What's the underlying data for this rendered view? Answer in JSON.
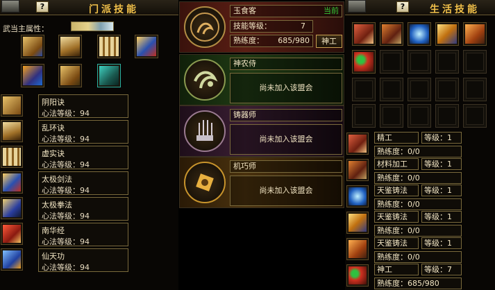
{
  "sect_panel": {
    "title": "门派技能",
    "help": "?",
    "attribute_label": "武当主属性：",
    "skill_icons": [
      "scroll-icon",
      "open-book-icon",
      "scroll-bundle-icon",
      "blue-book-icon",
      "spirit-book-icon",
      "scroll-icon",
      "green-book-icon"
    ],
    "skills": [
      {
        "name": "阴阳诀",
        "level": "心法等级：94",
        "icon": "scroll-icon"
      },
      {
        "name": "乱环诀",
        "level": "心法等级：94",
        "icon": "open-book-icon"
      },
      {
        "name": "虚实诀",
        "level": "心法等级：94",
        "icon": "scroll-bundle-icon"
      },
      {
        "name": "太极剑法",
        "level": "心法等级：94",
        "icon": "blue-book-icon"
      },
      {
        "name": "太极拳法",
        "level": "心法等级：94",
        "icon": "blue-book-icon"
      },
      {
        "name": "南华经",
        "level": "心法等级：94",
        "icon": "red-book-icon"
      },
      {
        "name": "仙天功",
        "level": "心法等级：94",
        "icon": "spirit-book-icon"
      }
    ]
  },
  "professions": [
    {
      "name": "玉食客",
      "status": "当前",
      "skill_level_label": "技能等级：",
      "skill_level_value": "7",
      "proficiency_label": "熟练度：",
      "proficiency_value": "685/980",
      "button": "神工",
      "emblem": "chef-emblem-icon",
      "color": "#5a1e14"
    },
    {
      "name": "神农侍",
      "message": "尚未加入该盟会",
      "emblem": "herb-emblem-icon",
      "color": "#1f3a14"
    },
    {
      "name": "铸器师",
      "message": "尚未加入该盟会",
      "emblem": "forge-emblem-icon",
      "color": "#3a1e33"
    },
    {
      "name": "机巧师",
      "message": "尚未加入该盟会",
      "emblem": "mechanism-emblem-icon",
      "color": "#4a320e"
    }
  ],
  "life_panel": {
    "title": "生活技能",
    "help": "?",
    "grid_icons": [
      "craft-hands-icon",
      "material-icon",
      "forge-blue-icon",
      "hammer-anvil-icon",
      "chest-icon",
      "gourd-icon"
    ],
    "rows": [
      {
        "name": "精工",
        "level": "等级：1",
        "proficiency": "熟练度：0/0",
        "icon": "craft-hands-icon"
      },
      {
        "name": "材料加工",
        "level": "等级：1",
        "proficiency": "熟练度：0/0",
        "icon": "material-icon"
      },
      {
        "name": "天鉴铸法",
        "level": "等级：1",
        "proficiency": "熟练度：0/0",
        "icon": "forge-blue-icon"
      },
      {
        "name": "天鉴铸法",
        "level": "等级：1",
        "proficiency": "熟练度：0/0",
        "icon": "hammer-anvil-icon"
      },
      {
        "name": "天鉴铸法",
        "level": "等级：1",
        "proficiency": "熟练度：0/0",
        "icon": "chest-icon"
      },
      {
        "name": "神工",
        "level": "等级：7",
        "proficiency": "熟练度：685/980",
        "icon": "gourd-icon"
      }
    ]
  },
  "colors": {
    "title": "#f1c04a",
    "status_green": "#37c837",
    "border": "#7a6a3c"
  }
}
